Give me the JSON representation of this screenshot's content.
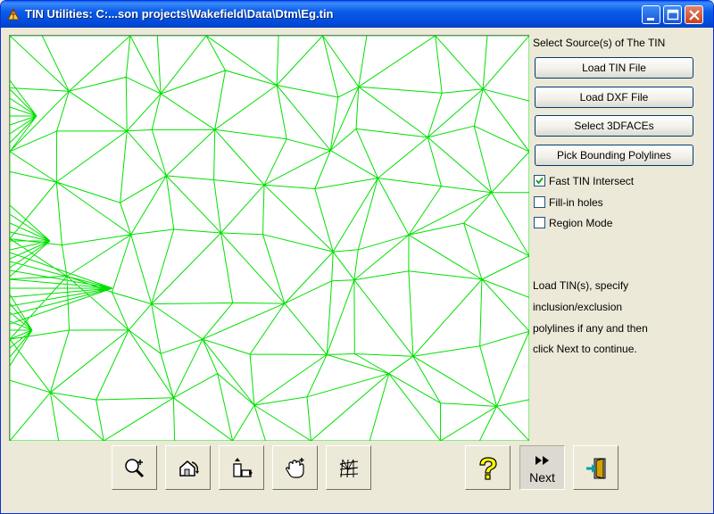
{
  "window": {
    "title": "TIN Utilities: C:...son projects\\Wakefield\\Data\\Dtm\\Eg.tin"
  },
  "titlebar_buttons": {
    "minimize": "minimize-icon",
    "maximize": "maximize-icon",
    "close": "close-icon"
  },
  "canvas": {
    "background": "#ffffff",
    "line_color": "#00e000"
  },
  "panel": {
    "heading": "Select Source(s) of The TIN",
    "buttons": [
      {
        "label": "Load TIN File"
      },
      {
        "label": "Load DXF File"
      },
      {
        "label": "Select 3DFACEs"
      },
      {
        "label": "Pick Bounding Polylines"
      }
    ],
    "checkboxes": [
      {
        "label": "Fast TIN Intersect",
        "checked": true
      },
      {
        "label": "Fill-in holes",
        "checked": false
      },
      {
        "label": "Region Mode",
        "checked": false
      }
    ],
    "info_lines": [
      "Load TIN(s), specify",
      "inclusion/exclusion",
      "polylines if any and then",
      "click Next to continue."
    ]
  },
  "toolbar": {
    "tools": [
      {
        "icon": "zoom-icon"
      },
      {
        "icon": "zoom-extents-icon"
      },
      {
        "icon": "zoom-window-icon"
      },
      {
        "icon": "pan-hand-icon"
      },
      {
        "icon": "mesh-icon"
      },
      {
        "icon": "help-icon"
      },
      {
        "icon": "next-arrows-icon",
        "label": "Next"
      },
      {
        "icon": "exit-door-icon"
      }
    ]
  }
}
